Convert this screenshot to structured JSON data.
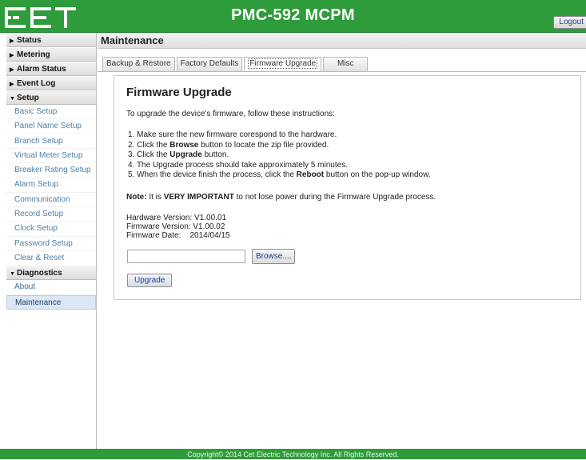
{
  "header": {
    "logo": "CET",
    "title": "PMC-592 MCPM",
    "logout_label": "Logout",
    "color": "#2e9c3a"
  },
  "sidebar": {
    "sections": [
      {
        "label": "Status",
        "expanded": false
      },
      {
        "label": "Metering",
        "expanded": false
      },
      {
        "label": "Alarm Status",
        "expanded": false
      },
      {
        "label": "Event Log",
        "expanded": false
      },
      {
        "label": "Setup",
        "expanded": true,
        "items": [
          "Basic Setup",
          "Panel Name Setup",
          "Branch Setup",
          "Virtual Meter Setup",
          "Breaker Rating Setup",
          "Alarm Setup",
          "Communication",
          "Record Setup",
          "Clock Setup",
          "Password Setup",
          "Clear & Reset"
        ]
      },
      {
        "label": "Diagnostics",
        "expanded": true,
        "items": [
          "About",
          "Maintenance"
        ]
      }
    ],
    "active_item": "Maintenance"
  },
  "main": {
    "title": "Maintenance",
    "tabs": [
      "Backup & Restore",
      "Factory Defaults",
      "Firmware Upgrade",
      "Misc"
    ],
    "active_tab": "Firmware Upgrade"
  },
  "panel": {
    "title": "Firmware Upgrade",
    "intro": "To upgrade the device's firmware, follow these instructions:",
    "steps": {
      "s1": "1.  Make sure the new firmware corespond to the hardware.",
      "s2_pre": "2.  Click the ",
      "s2_bold": "Browse",
      "s2_post": " button to locate the zip file provided.",
      "s3_pre": "3.  Click the ",
      "s3_bold": "Upgrade",
      "s3_post": " button.",
      "s4": "4.  The Upgrade process should take approximately 5 minutes.",
      "s5_pre": "5.  When the device finish the process, click the ",
      "s5_bold": "Reboot",
      "s5_post": " button on the pop-up window."
    },
    "note": {
      "label": "Note:",
      "pre": " It is ",
      "bold": "VERY IMPORTANT",
      "post": " to not lose power during the Firmware Upgrade process."
    },
    "versions": {
      "hardware_label": "Hardware Version:",
      "hardware_value": "V1.00.01",
      "firmware_label": "Firmware Version:",
      "firmware_value": "V1.00.02",
      "date_label": "Firmware Date:",
      "date_value": "2014/04/15"
    },
    "file_input_value": "",
    "browse_label": "Browse....",
    "upgrade_label": "Upgrade"
  },
  "footer": {
    "text": "Copyright© 2014 Cet Electric Technology Inc. All Rights Reserved."
  }
}
